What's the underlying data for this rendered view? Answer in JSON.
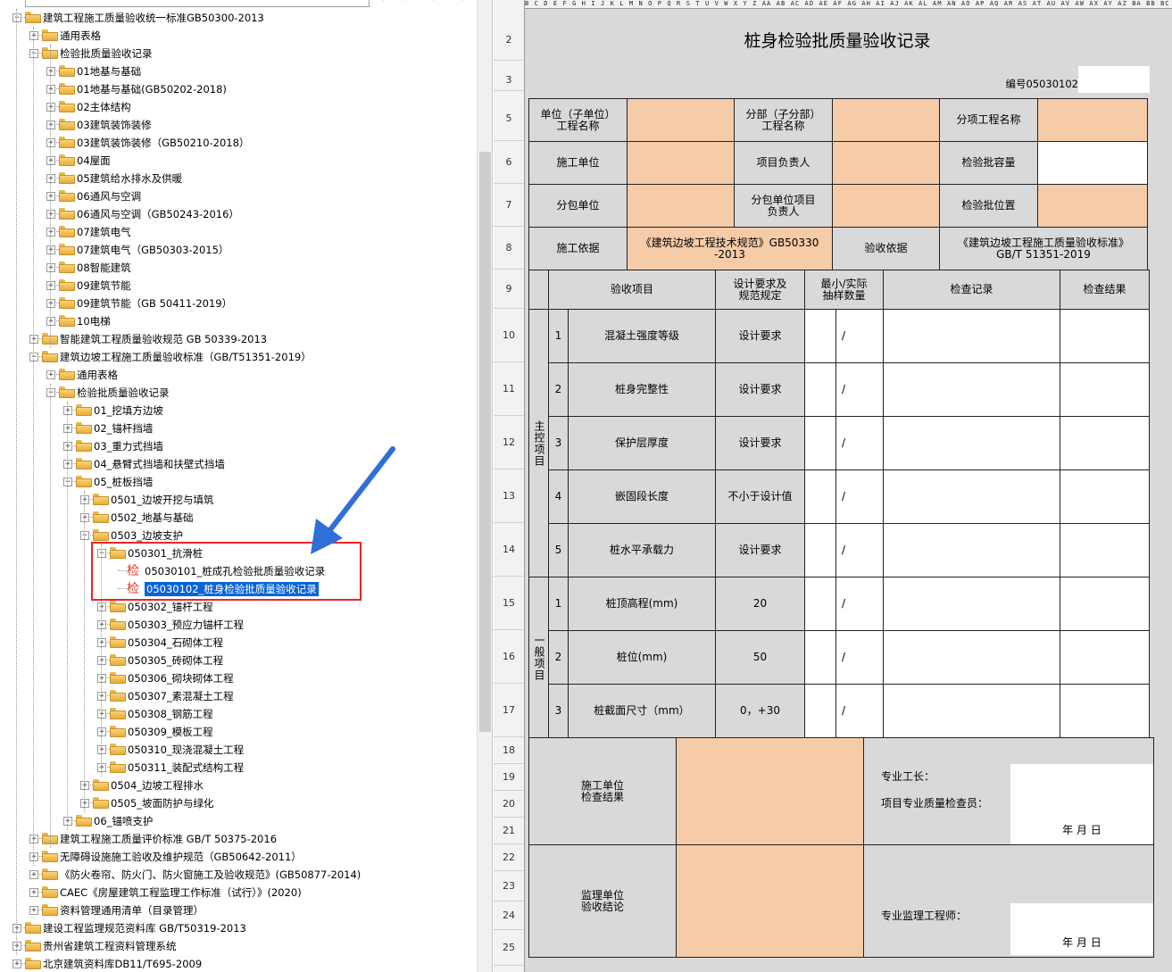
{
  "tree": {
    "rows": [
      {
        "label": "建筑工程施工质量验收统一标准GB50300-2013",
        "expander": "-"
      },
      {
        "label": "通用表格",
        "expander": "+"
      },
      {
        "label": "检验批质量验收记录",
        "expander": "-"
      },
      {
        "label": "01地基与基础",
        "expander": "+"
      },
      {
        "label": "01地基与基础(GB50202-2018)",
        "expander": "+"
      },
      {
        "label": "02主体结构",
        "expander": "+"
      },
      {
        "label": "03建筑装饰装修",
        "expander": "+"
      },
      {
        "label": "03建筑装饰装修（GB50210-2018）",
        "expander": "+"
      },
      {
        "label": "04屋面",
        "expander": "+"
      },
      {
        "label": "05建筑给水排水及供暖",
        "expander": "+"
      },
      {
        "label": "06通风与空调",
        "expander": "+"
      },
      {
        "label": "06通风与空调（GB50243-2016）",
        "expander": "+"
      },
      {
        "label": "07建筑电气",
        "expander": "+"
      },
      {
        "label": "07建筑电气（GB50303-2015）",
        "expander": "+"
      },
      {
        "label": "08智能建筑",
        "expander": "+"
      },
      {
        "label": "09建筑节能",
        "expander": "+"
      },
      {
        "label": "09建筑节能（GB 50411-2019）",
        "expander": "+"
      },
      {
        "label": "10电梯",
        "expander": "+"
      },
      {
        "label": "智能建筑工程质量验收规范 GB 50339-2013",
        "expander": "+"
      },
      {
        "label": "建筑边坡工程施工质量验收标准（GB/T51351-2019）",
        "expander": "-"
      },
      {
        "label": "通用表格",
        "expander": "+"
      },
      {
        "label": "检验批质量验收记录",
        "expander": "-"
      },
      {
        "label": "01_挖填方边坡",
        "expander": "+"
      },
      {
        "label": "02_锚杆挡墙",
        "expander": "+"
      },
      {
        "label": "03_重力式挡墙",
        "expander": "+"
      },
      {
        "label": "04_悬臂式挡墙和扶壁式挡墙",
        "expander": "+"
      },
      {
        "label": "05_桩板挡墙",
        "expander": "-"
      },
      {
        "label": "0501_边坡开挖与填筑",
        "expander": "+"
      },
      {
        "label": "0502_地基与基础",
        "expander": "+"
      },
      {
        "label": "0503_边坡支护",
        "expander": "-"
      },
      {
        "label": "050301_抗滑桩",
        "expander": "-"
      },
      {
        "label": "05030101_桩成孔检验批质量验收记录",
        "expander": ""
      },
      {
        "label": "05030102_桩身检验批质量验收记录",
        "expander": ""
      },
      {
        "label": "050302_锚杆工程",
        "expander": "+"
      },
      {
        "label": "050303_预应力锚杆工程",
        "expander": "+"
      },
      {
        "label": "050304_石砌体工程",
        "expander": "+"
      },
      {
        "label": "050305_砖砌体工程",
        "expander": "+"
      },
      {
        "label": "050306_砌块砌体工程",
        "expander": "+"
      },
      {
        "label": "050307_素混凝土工程",
        "expander": "+"
      },
      {
        "label": "050308_钢筋工程",
        "expander": "+"
      },
      {
        "label": "050309_模板工程",
        "expander": "+"
      },
      {
        "label": "050310_现浇混凝土工程",
        "expander": "+"
      },
      {
        "label": "050311_装配式结构工程",
        "expander": "+"
      },
      {
        "label": "0504_边坡工程排水",
        "expander": "+"
      },
      {
        "label": "0505_坡面防护与绿化",
        "expander": "+"
      },
      {
        "label": "06_锚喷支护",
        "expander": "+"
      },
      {
        "label": "建筑工程施工质量评价标准 GB/T 50375-2016",
        "expander": "+"
      },
      {
        "label": "无障碍设施施工验收及维护规范（GB50642-2011）",
        "expander": "+"
      },
      {
        "label": "《防火卷帘、防火门、防火窗施工及验收规范》(GB50877-2014)",
        "expander": "+"
      },
      {
        "label": "CAEC《房屋建筑工程监理工作标准（试行）》(2020)",
        "expander": "+"
      },
      {
        "label": "资料管理通用清单（目录管理）",
        "expander": "+"
      },
      {
        "label": "建设工程监理规范资料库 GB/T50319-2013",
        "expander": "+"
      },
      {
        "label": "贵州省建筑工程资料管理系统",
        "expander": "+"
      },
      {
        "label": "北京建筑资料库DB11/T695-2009",
        "expander": "+"
      }
    ],
    "doc_icon_char": "检",
    "toolbar_icons": [
      "search-icon",
      "dropdown-icon"
    ]
  },
  "sheet": {
    "column_letters": "B C D E F G H I J K L M N O P Q R S T U V W X Y Z AA AB AC AD AE AF AG AH AI AJ AK AL AM AN AO AP AQ AR AS AT AU AV AW AX AY AZ BA BB BC BD BE BF BG BH BI BJ BK BL BM BN BO BP BQ BR BS",
    "row_numbers": [
      "2",
      "3",
      "5",
      "6",
      "7",
      "8",
      "9",
      "10",
      "11",
      "12",
      "13",
      "14",
      "15",
      "16",
      "17",
      "18",
      "19",
      "20",
      "21",
      "22",
      "23",
      "24",
      "25"
    ],
    "title": "桩身检验批质量验收记录",
    "code_label": "编号05030102",
    "header": {
      "unit_name": "单位（子单位）\n工程名称",
      "sub_name": "分部（子分部）\n工程名称",
      "item_name": "分项工程名称",
      "construction_unit": "施工单位",
      "project_leader": "项目负责人",
      "batch_capacity": "检验批容量",
      "subcontract_unit": "分包单位",
      "subcontract_leader": "分包单位项目\n负责人",
      "batch_location": "检验批位置",
      "construction_basis": "施工依据",
      "construction_basis_value": "《建筑边坡工程技术规范》GB50330\n-2013",
      "acceptance_basis": "验收依据",
      "acceptance_basis_value": "《建筑边坡工程施工质量验收标准》\nGB/T 51351-2019"
    },
    "columns": {
      "item": "验收项目",
      "design": "设计要求及\n规范规定",
      "sample": "最小/实际\n抽样数量",
      "record": "检查记录",
      "result": "检查结果"
    },
    "main_group_label": "主控项目",
    "general_group_label": "一般项目",
    "main_items": [
      {
        "no": "1",
        "name": "混凝土强度等级",
        "req": "设计要求",
        "slash": "/"
      },
      {
        "no": "2",
        "name": "桩身完整性",
        "req": "设计要求",
        "slash": "/"
      },
      {
        "no": "3",
        "name": "保护层厚度",
        "req": "设计要求",
        "slash": "/"
      },
      {
        "no": "4",
        "name": "嵌固段长度",
        "req": "不小于设计值",
        "slash": "/"
      },
      {
        "no": "5",
        "name": "桩水平承载力",
        "req": "设计要求",
        "slash": "/"
      }
    ],
    "general_items": [
      {
        "no": "1",
        "name": "桩顶高程(mm)",
        "req": "20",
        "slash": "/"
      },
      {
        "no": "2",
        "name": "桩位(mm)",
        "req": "50",
        "slash": "/"
      },
      {
        "no": "3",
        "name": "桩截面尺寸（mm）",
        "req": "0，+30",
        "slash": "/"
      }
    ],
    "construction_result_label": "施工单位\n检查结果",
    "foreman_label": "专业工长：",
    "inspector_label": "项目专业质量检查员：",
    "date_label": "年    月    日",
    "supervisor_result_label": "监理单位\n验收结论",
    "supervisor_engineer_label": "专业监理工程师：",
    "date_label2": "年    月    日"
  },
  "colors": {
    "orange": "#f5cba8",
    "gray": "#d9d9d9",
    "selection": "#0a64d8",
    "highlight_box": "#e8262a",
    "arrow": "#2f6fd6"
  }
}
